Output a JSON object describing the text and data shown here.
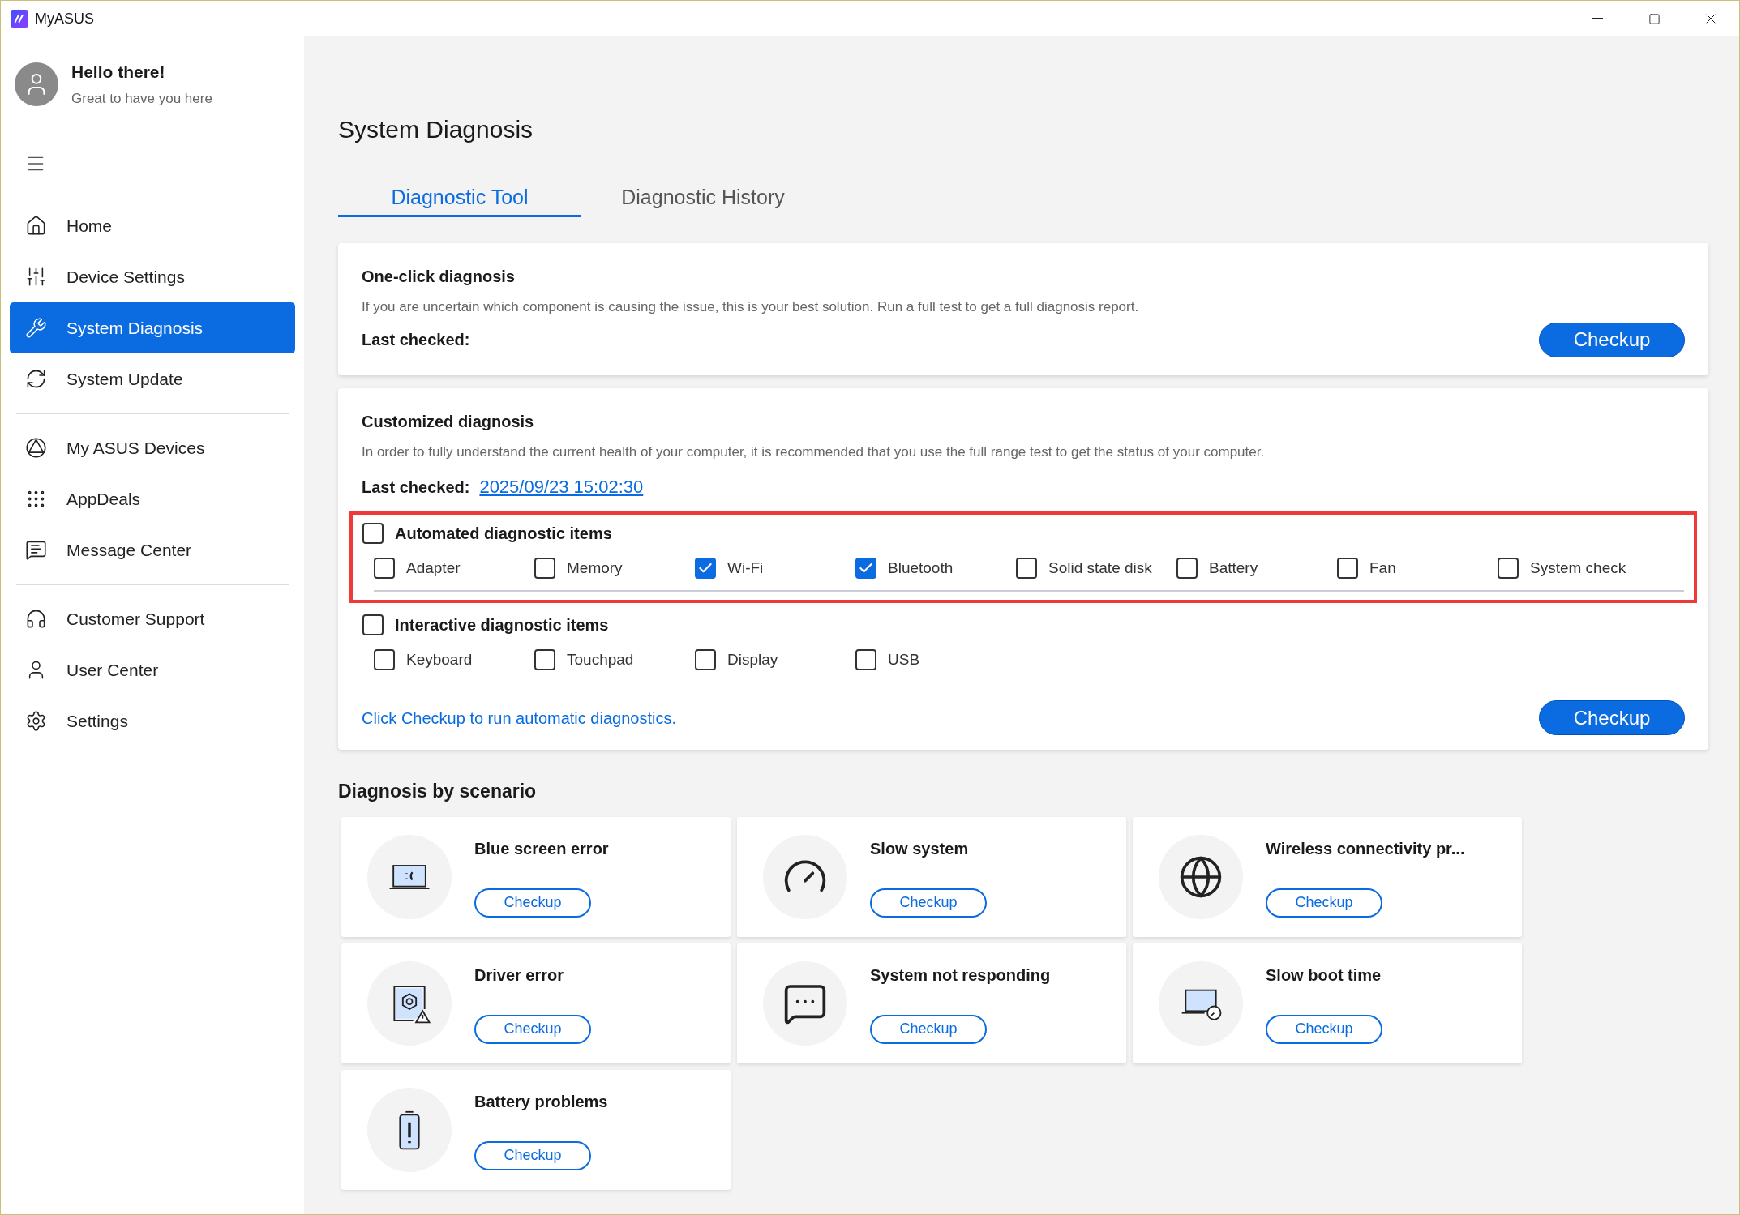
{
  "window": {
    "title": "MyASUS"
  },
  "profile": {
    "greeting": "Hello there!",
    "subtitle": "Great to have you here"
  },
  "sidebar": {
    "groups": [
      {
        "items": [
          {
            "label": "Home",
            "selected": false
          },
          {
            "label": "Device Settings",
            "selected": false
          },
          {
            "label": "System Diagnosis",
            "selected": true
          },
          {
            "label": "System Update",
            "selected": false
          }
        ]
      },
      {
        "items": [
          {
            "label": "My ASUS Devices",
            "selected": false
          },
          {
            "label": "AppDeals",
            "selected": false
          },
          {
            "label": "Message Center",
            "selected": false
          }
        ]
      },
      {
        "items": [
          {
            "label": "Customer Support",
            "selected": false
          },
          {
            "label": "User Center",
            "selected": false
          },
          {
            "label": "Settings",
            "selected": false
          }
        ]
      }
    ]
  },
  "main": {
    "title": "System Diagnosis",
    "tabs": [
      {
        "label": "Diagnostic Tool",
        "selected": true
      },
      {
        "label": "Diagnostic History",
        "selected": false
      }
    ],
    "one_click": {
      "title": "One-click diagnosis",
      "description": "If you are uncertain which component is causing the issue, this is your best solution. Run a full test to get a full diagnosis report.",
      "last_checked_label": "Last checked:",
      "button": "Checkup"
    },
    "customized": {
      "title": "Customized diagnosis",
      "description": "In order to fully understand the current health of your computer, it is recommended that you use the full range test to get the status of your computer.",
      "last_checked_label": "Last checked:",
      "last_checked_value": "2025/09/23 15:02:30",
      "groups": [
        {
          "label": "Automated diagnostic items",
          "checked": false,
          "highlighted": true,
          "items": [
            {
              "label": "Adapter",
              "checked": false
            },
            {
              "label": "Memory",
              "checked": false
            },
            {
              "label": "Wi-Fi",
              "checked": true
            },
            {
              "label": "Bluetooth",
              "checked": true
            },
            {
              "label": "Solid state disk",
              "checked": false
            },
            {
              "label": "Battery",
              "checked": false
            },
            {
              "label": "Fan",
              "checked": false
            },
            {
              "label": "System check",
              "checked": false
            }
          ]
        },
        {
          "label": "Interactive diagnostic items",
          "checked": false,
          "highlighted": false,
          "items": [
            {
              "label": "Keyboard",
              "checked": false
            },
            {
              "label": "Touchpad",
              "checked": false
            },
            {
              "label": "Display",
              "checked": false
            },
            {
              "label": "USB",
              "checked": false
            }
          ]
        }
      ],
      "hint": "Click Checkup to run automatic diagnostics.",
      "button": "Checkup"
    },
    "scenarios": {
      "title": "Diagnosis by scenario",
      "cards": [
        {
          "title": "Blue screen error",
          "button": "Checkup"
        },
        {
          "title": "Slow system",
          "button": "Checkup"
        },
        {
          "title": "Wireless connectivity pr...",
          "button": "Checkup"
        },
        {
          "title": "Driver error",
          "button": "Checkup"
        },
        {
          "title": "System not responding",
          "button": "Checkup"
        },
        {
          "title": "Slow boot time",
          "button": "Checkup"
        },
        {
          "title": "Battery problems",
          "button": "Checkup"
        }
      ]
    }
  }
}
